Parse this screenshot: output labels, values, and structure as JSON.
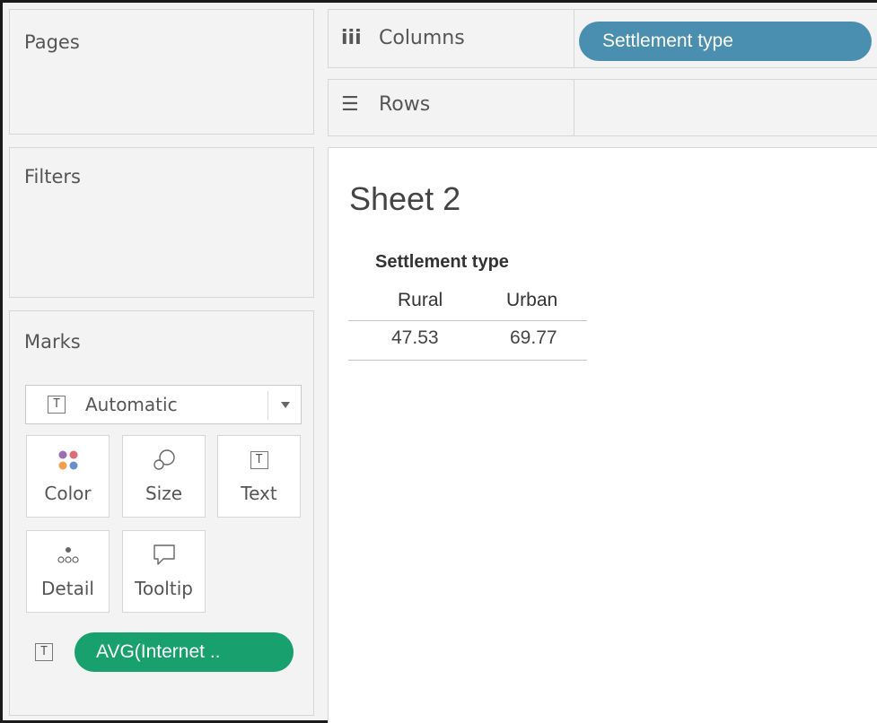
{
  "shelves": {
    "pages_label": "Pages",
    "filters_label": "Filters",
    "columns": {
      "icon": "columns-icon",
      "label": "Columns",
      "pill": "Settlement type",
      "pill_color": "#4b8fb0"
    },
    "rows": {
      "icon": "rows-icon",
      "label": "Rows"
    }
  },
  "marks": {
    "title": "Marks",
    "mark_type": {
      "icon": "text-icon",
      "glyph": "T",
      "label": "Automatic"
    },
    "buttons": [
      {
        "icon": "color-icon",
        "label": "Color"
      },
      {
        "icon": "size-icon",
        "label": "Size"
      },
      {
        "icon": "text-icon",
        "label": "Text",
        "glyph": "T"
      },
      {
        "icon": "detail-icon",
        "label": "Detail"
      },
      {
        "icon": "tooltip-icon",
        "label": "Tooltip"
      }
    ],
    "pill": {
      "icon": "text-icon",
      "glyph": "T",
      "label": "AVG(Internet ..",
      "color": "#18a06f"
    }
  },
  "view": {
    "sheet_title": "Sheet 2",
    "column_header": "Settlement type",
    "columns": [
      "Rural",
      "Urban"
    ],
    "values": [
      "47.53",
      "69.77"
    ]
  }
}
